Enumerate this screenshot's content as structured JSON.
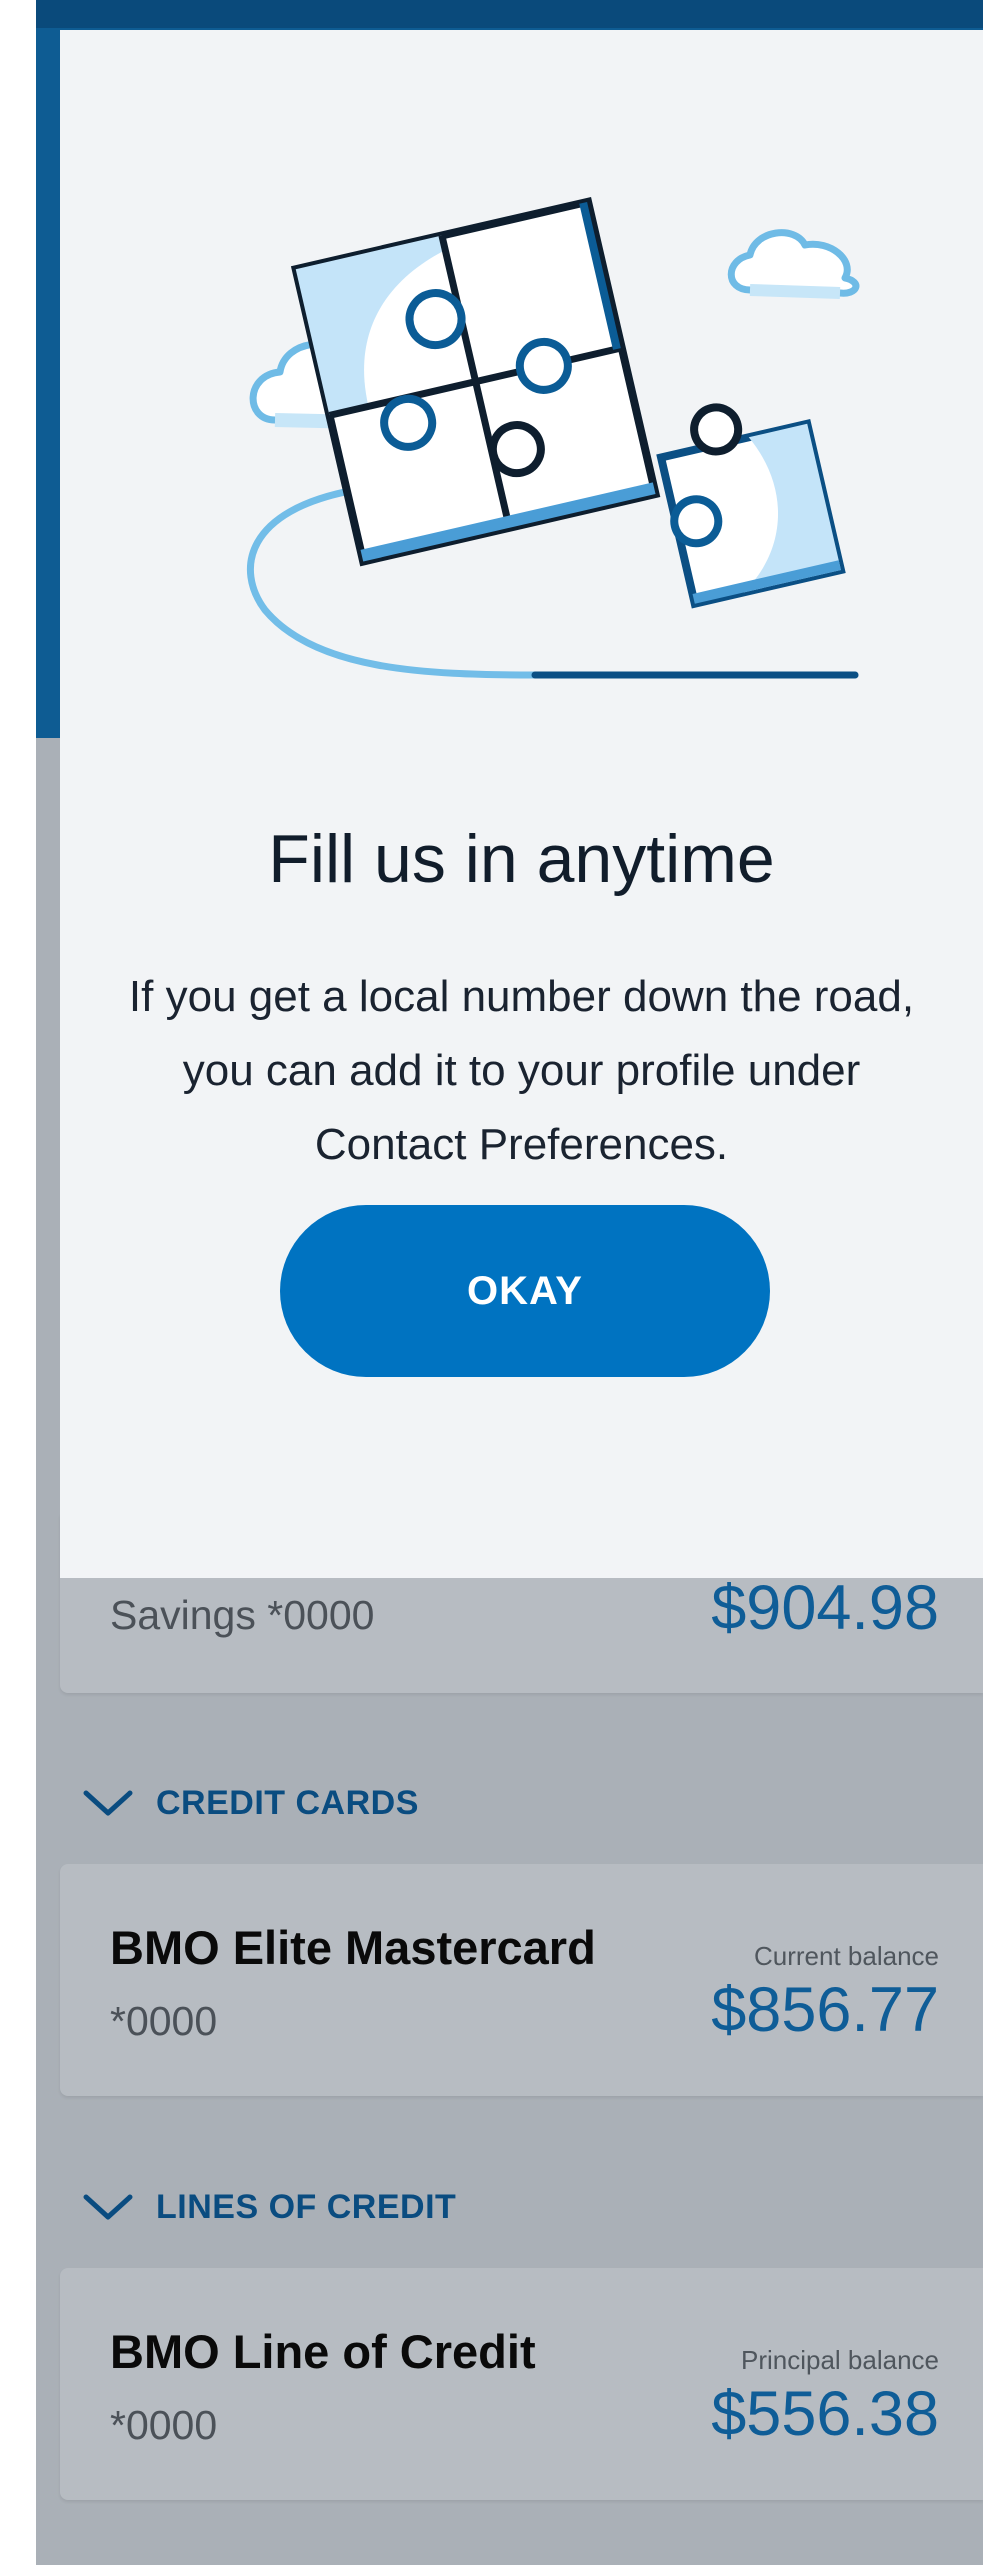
{
  "modal": {
    "title": "Fill us in anytime",
    "body": "If you get a local number down the road, you can add it to your profile under Contact Preferences.",
    "button_label": "OKAY",
    "illustration_icon": "puzzle-pieces-illustration"
  },
  "accounts": {
    "savings": {
      "number": "Savings *0000",
      "balance": "$904.98"
    },
    "credit_cards": {
      "section_label": "CREDIT CARDS",
      "card": {
        "name": "BMO Elite Mastercard",
        "number": "*0000",
        "balance_label": "Current balance",
        "balance": "$856.77"
      }
    },
    "lines_of_credit": {
      "section_label": "LINES OF CREDIT",
      "card": {
        "name": "BMO Line of Credit",
        "number": "*0000",
        "balance_label": "Principal balance",
        "balance": "$556.38"
      }
    }
  },
  "colors": {
    "brand_blue": "#0073c1",
    "header_blue": "#0e5c93",
    "overlay_grey": "#aab0b7",
    "modal_bg": "#f2f4f6",
    "balance_blue": "#0f5d97"
  }
}
